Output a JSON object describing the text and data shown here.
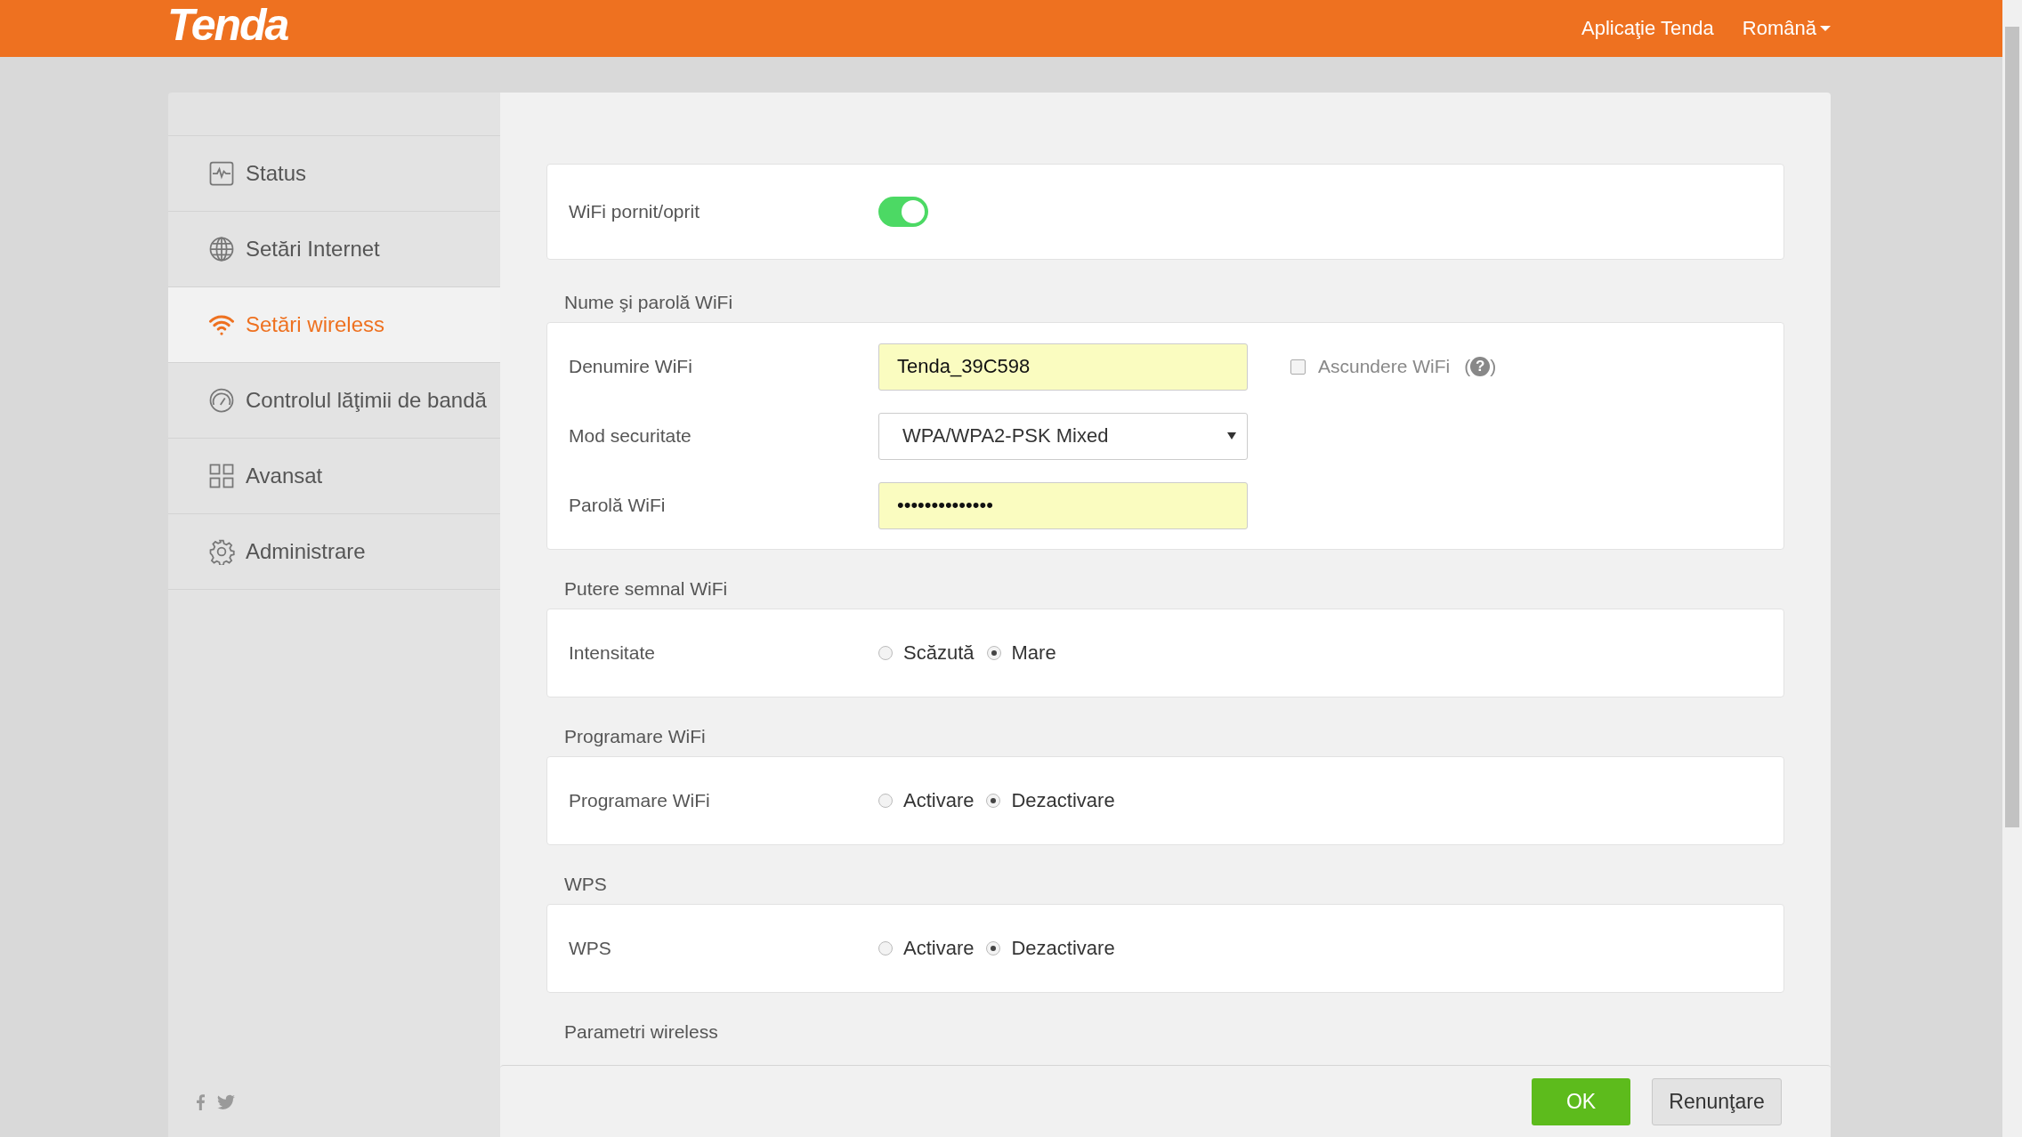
{
  "header": {
    "logo": "Tenda",
    "app_link": "Aplicaţie Tenda",
    "language": "Română"
  },
  "sidebar": {
    "items": [
      {
        "label": "Status",
        "selected": false
      },
      {
        "label": "Setări Internet",
        "selected": false
      },
      {
        "label": "Setări wireless",
        "selected": true
      },
      {
        "label": "Controlul lăţimii de bandă",
        "selected": false
      },
      {
        "label": "Avansat",
        "selected": false
      },
      {
        "label": "Administrare",
        "selected": false
      }
    ]
  },
  "sections": [
    {
      "rows": [
        {
          "kind": "toggle",
          "label": "WiFi pornit/oprit",
          "on": true
        }
      ]
    },
    {
      "title": "Nume şi parolă WiFi",
      "rows": [
        {
          "kind": "text",
          "label": "Denumire WiFi",
          "value": "Tenda_39C598",
          "extra": {
            "label": "Ascundere WiFi",
            "checked": false,
            "help": {
              "open": "(",
              "mark": "?",
              "close": ")"
            }
          }
        },
        {
          "kind": "select",
          "label": "Mod securitate",
          "value": "WPA/WPA2-PSK Mixed"
        },
        {
          "kind": "text",
          "label": "Parolă WiFi",
          "value": "••••••••••••••"
        }
      ]
    },
    {
      "title": "Putere semnal WiFi",
      "rows": [
        {
          "kind": "radio",
          "label": "Intensitate",
          "options": [
            {
              "label": "Scăzută",
              "selected": false
            },
            {
              "label": "Mare",
              "selected": true
            }
          ]
        }
      ]
    },
    {
      "title": "Programare WiFi",
      "rows": [
        {
          "kind": "radio",
          "label": "Programare WiFi",
          "options": [
            {
              "label": "Activare",
              "selected": false
            },
            {
              "label": "Dezactivare",
              "selected": true
            }
          ]
        }
      ]
    },
    {
      "title": "WPS",
      "rows": [
        {
          "kind": "radio",
          "label": "WPS",
          "options": [
            {
              "label": "Activare",
              "selected": false
            },
            {
              "label": "Dezactivare",
              "selected": true
            }
          ]
        }
      ]
    },
    {
      "title": "Parametri wireless"
    }
  ],
  "buttons": {
    "ok": "OK",
    "cancel": "Renunţare"
  }
}
